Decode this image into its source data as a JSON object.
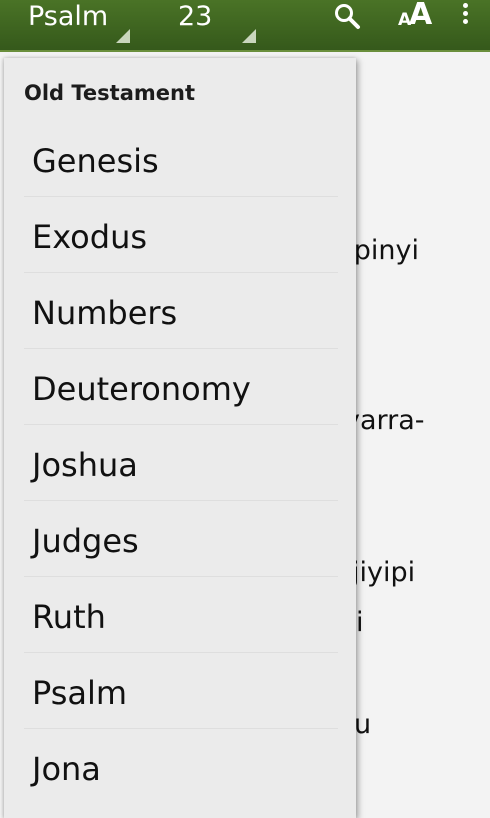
{
  "toolbar": {
    "book_spinner": "Psalm",
    "chapter_spinner": "23",
    "font_button_small": "A",
    "font_button_large": "A"
  },
  "background_text": {
    "fragments": [
      "-pinyi",
      "yarra-",
      "jiyipi",
      "i",
      "u"
    ]
  },
  "dropdown": {
    "section_header": "Old Testament",
    "books": [
      {
        "label": "Genesis"
      },
      {
        "label": "Exodus"
      },
      {
        "label": "Numbers"
      },
      {
        "label": "Deuteronomy"
      },
      {
        "label": "Joshua"
      },
      {
        "label": "Judges"
      },
      {
        "label": "Ruth"
      },
      {
        "label": "Psalm"
      },
      {
        "label": "Jona"
      }
    ]
  },
  "icons": {
    "search": "search-icon",
    "font_size": "font-size-icon",
    "overflow": "more-vertical-icon",
    "spinner": "spinner-corner-triangle-icon"
  },
  "colors": {
    "toolbar_green": "#3f6821",
    "toolbar_text": "#ffffff",
    "dropdown_bg": "#ebebeb",
    "page_bg": "#f3f3f3"
  }
}
